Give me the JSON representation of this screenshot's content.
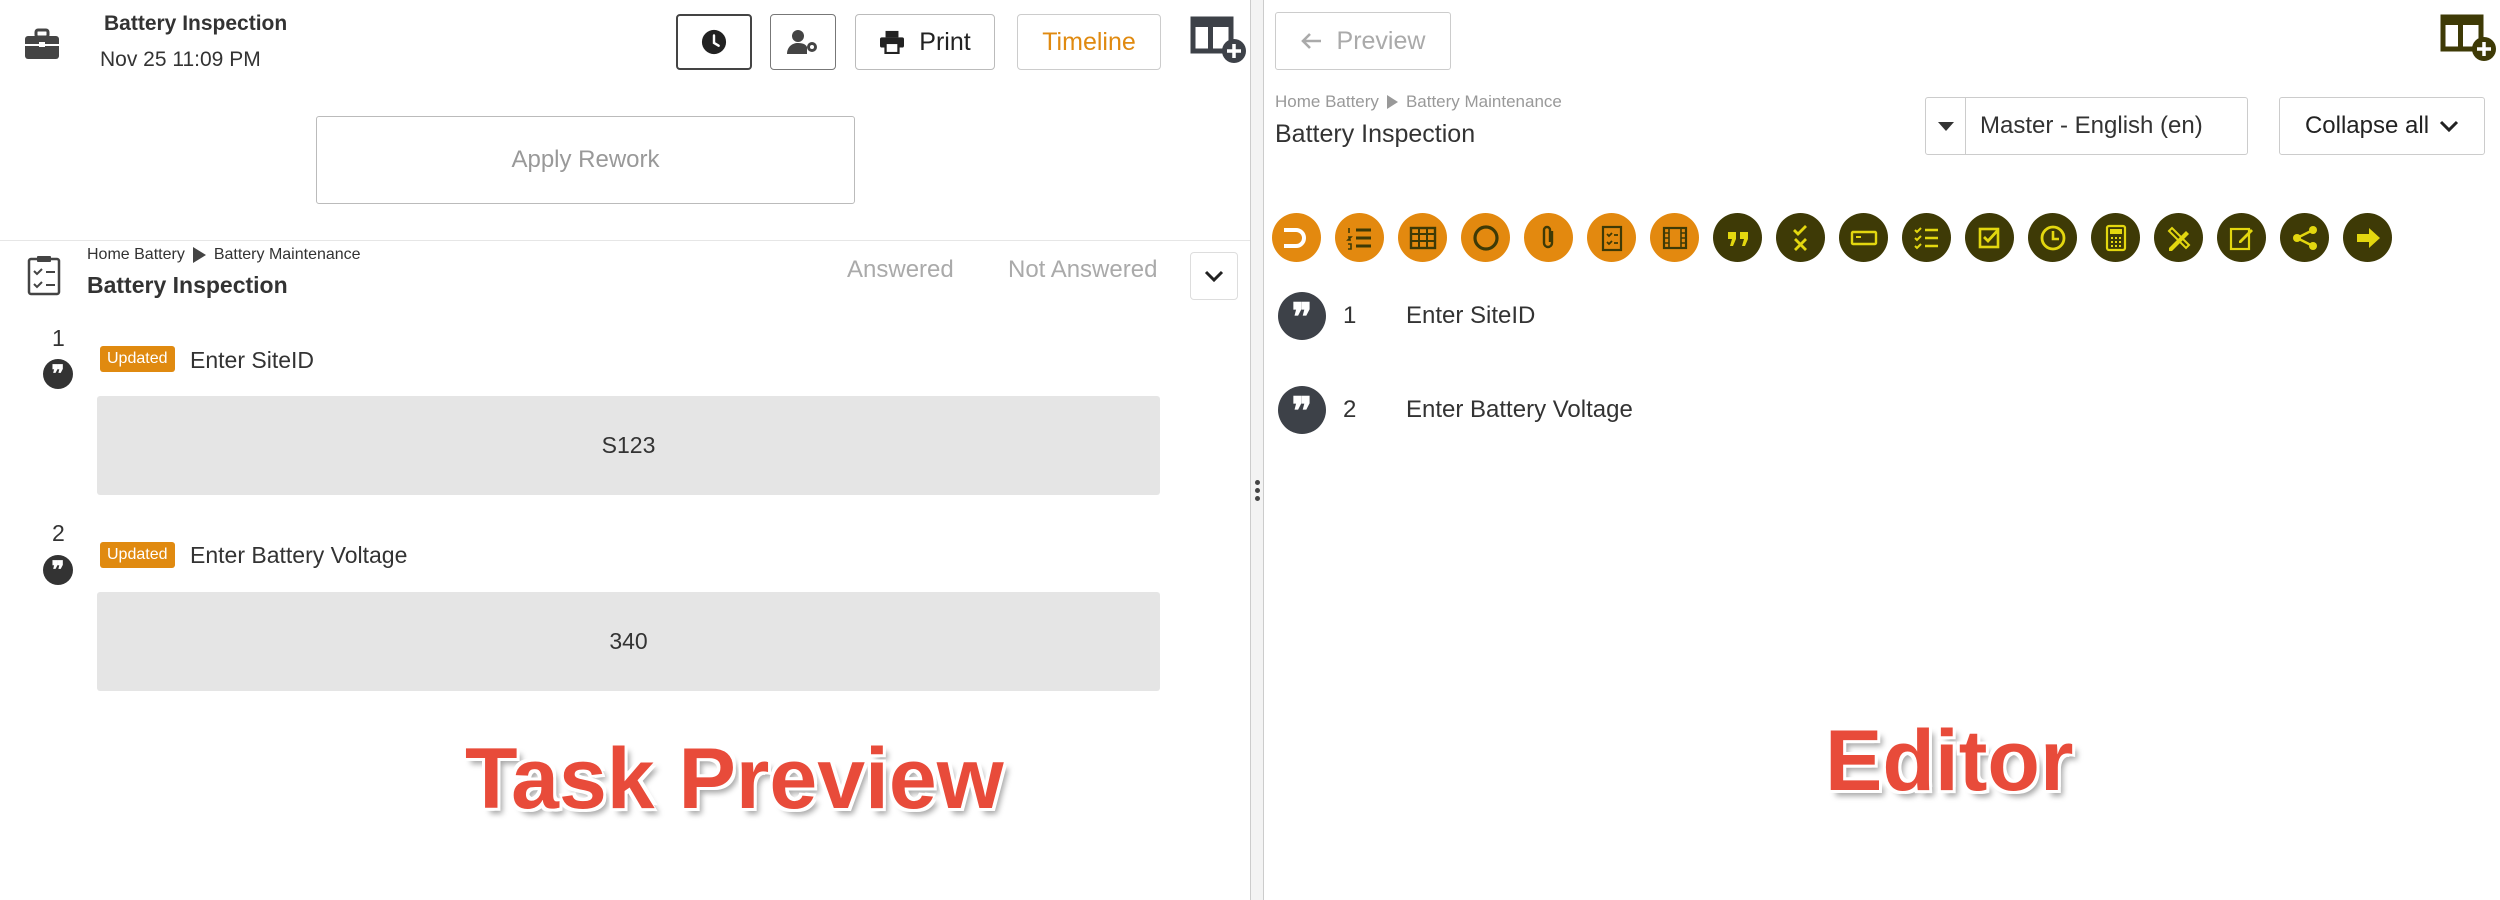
{
  "task": {
    "title": "Battery Inspection",
    "date": "Nov 25 11:09 PM"
  },
  "toolbar": {
    "print_label": "Print",
    "timeline_label": "Timeline",
    "apply_rework_label": "Apply Rework"
  },
  "left": {
    "breadcrumb": [
      "Home Battery",
      "Battery Maintenance"
    ],
    "section_title": "Battery Inspection",
    "filters": {
      "answered": "Answered",
      "not_answered": "Not Answered"
    },
    "questions": [
      {
        "number": "1",
        "badge": "Updated",
        "label": "Enter SiteID",
        "answer": "S123"
      },
      {
        "number": "2",
        "badge": "Updated",
        "label": "Enter Battery Voltage",
        "answer": "340"
      }
    ],
    "overlay_label": "Task Preview"
  },
  "right": {
    "preview_label": "Preview",
    "breadcrumb": [
      "Home Battery",
      "Battery Maintenance"
    ],
    "title": "Battery Inspection",
    "language": "Master - English (en)",
    "collapse_label": "Collapse all",
    "palette": [
      {
        "icon": "toggle-icon",
        "color": "#e3890f"
      },
      {
        "icon": "numbered-list-icon",
        "color": "#e3890f"
      },
      {
        "icon": "table-icon",
        "color": "#e3890f"
      },
      {
        "icon": "circle-icon",
        "color": "#e3890f"
      },
      {
        "icon": "attachment-icon",
        "color": "#e3890f"
      },
      {
        "icon": "checklist-doc-icon",
        "color": "#e3890f"
      },
      {
        "icon": "film-icon",
        "color": "#e3890f"
      },
      {
        "icon": "quote-icon",
        "color": "#3e3a06"
      },
      {
        "icon": "check-cross-icon",
        "color": "#3e3a06"
      },
      {
        "icon": "input-field-icon",
        "color": "#3e3a06"
      },
      {
        "icon": "multi-check-icon",
        "color": "#3e3a06"
      },
      {
        "icon": "checkbox-icon",
        "color": "#3e3a06"
      },
      {
        "icon": "clock-icon",
        "color": "#3e3a06"
      },
      {
        "icon": "calculator-icon",
        "color": "#3e3a06"
      },
      {
        "icon": "pencil-ruler-icon",
        "color": "#3e3a06"
      },
      {
        "icon": "signature-icon",
        "color": "#3e3a06"
      },
      {
        "icon": "share-icon",
        "color": "#3e3a06"
      },
      {
        "icon": "arrow-right-icon",
        "color": "#3e3a06"
      }
    ],
    "items": [
      {
        "number": "1",
        "label": "Enter SiteID"
      },
      {
        "number": "2",
        "label": "Enter Battery Voltage"
      }
    ],
    "overlay_label": "Editor"
  },
  "colors": {
    "accent": "#e08a10",
    "overlay": "#e84b3a",
    "palette_dark": "#3e3a06"
  }
}
